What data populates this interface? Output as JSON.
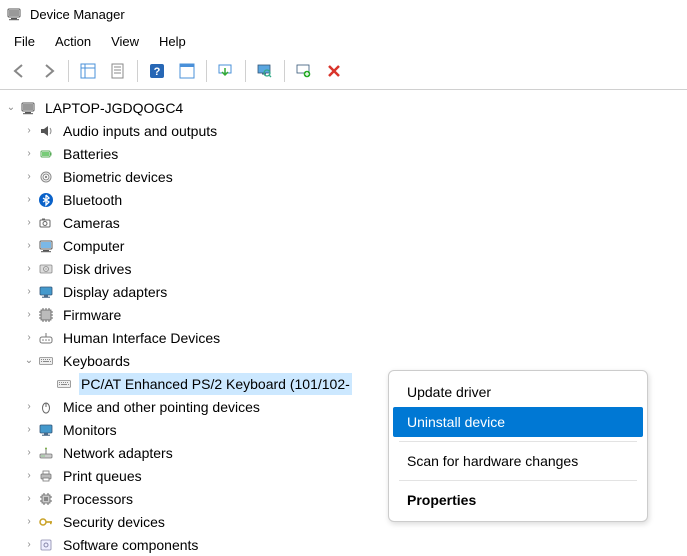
{
  "title": "Device Manager",
  "menubar": {
    "file": "File",
    "action": "Action",
    "view": "View",
    "help": "Help"
  },
  "root": "LAPTOP-JGDQOGC4",
  "nodes": {
    "audio": "Audio inputs and outputs",
    "batteries": "Batteries",
    "biometric": "Biometric devices",
    "bluetooth": "Bluetooth",
    "cameras": "Cameras",
    "computer": "Computer",
    "disk": "Disk drives",
    "display": "Display adapters",
    "firmware": "Firmware",
    "hid": "Human Interface Devices",
    "keyboards": "Keyboards",
    "keyboard_item": "PC/AT Enhanced PS/2 Keyboard (101/102-",
    "mice": "Mice and other pointing devices",
    "monitors": "Monitors",
    "network": "Network adapters",
    "printq": "Print queues",
    "processors": "Processors",
    "security": "Security devices",
    "software": "Software components"
  },
  "context_menu": {
    "update": "Update driver",
    "uninstall": "Uninstall device",
    "scan": "Scan for hardware changes",
    "properties": "Properties"
  }
}
